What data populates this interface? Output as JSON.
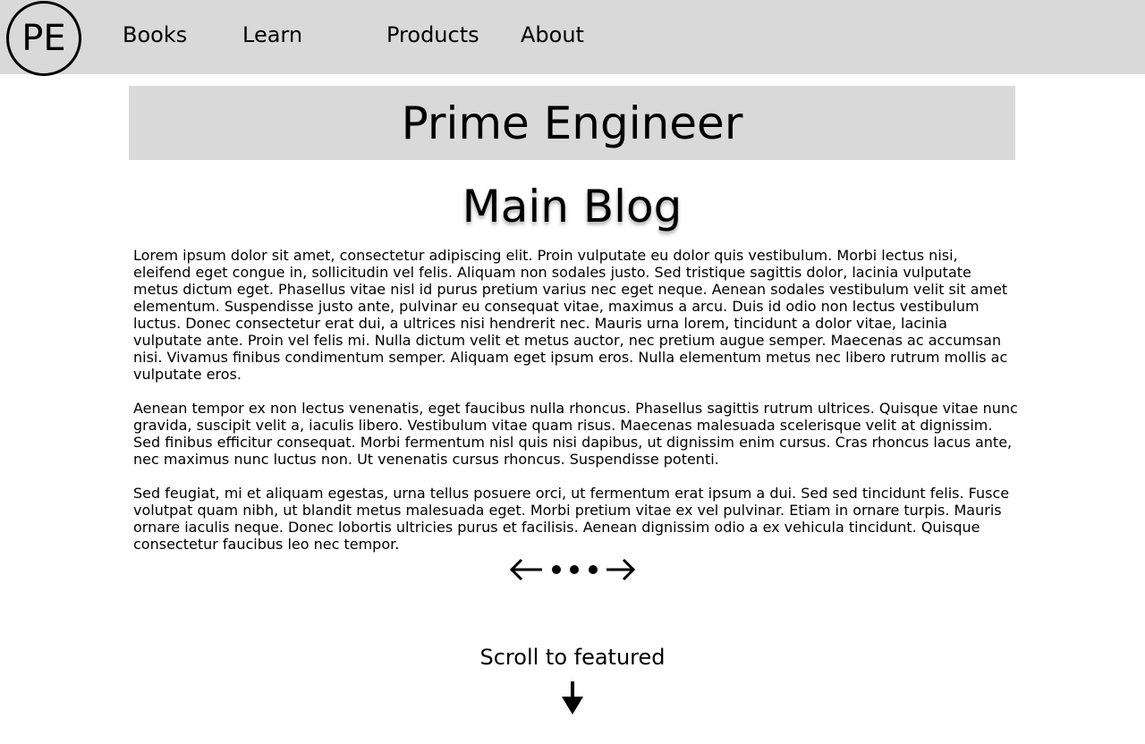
{
  "nav": {
    "logo_text": "PE",
    "items": [
      {
        "label": "Books"
      },
      {
        "label": "Learn"
      },
      {
        "label": "Products"
      },
      {
        "label": "About"
      }
    ]
  },
  "banner": {
    "title": "Prime Engineer"
  },
  "blog": {
    "heading": "Main Blog",
    "paragraphs": [
      "Lorem ipsum dolor sit amet, consectetur adipiscing elit. Proin vulputate eu dolor quis vestibulum. Morbi lectus nisi, eleifend eget congue in, sollicitudin vel felis. Aliquam non sodales justo. Sed tristique sagittis dolor, lacinia vulputate metus dictum eget. Phasellus vitae nisl id purus pretium varius nec eget neque. Aenean sodales vestibulum velit sit amet elementum. Suspendisse justo ante, pulvinar eu consequat vitae, maximus a arcu. Duis id odio non lectus vestibulum luctus. Donec consectetur erat dui, a ultrices nisi hendrerit nec. Mauris urna lorem, tincidunt a dolor vitae, lacinia vulputate ante. Proin vel felis mi. Nulla dictum velit et metus auctor, nec pretium augue semper. Maecenas ac accumsan nisi. Vivamus finibus condimentum semper. Aliquam eget ipsum eros. Nulla elementum metus nec libero rutrum mollis ac vulputate eros.",
      "Aenean tempor ex non lectus venenatis, eget faucibus nulla rhoncus. Phasellus sagittis rutrum ultrices. Quisque vitae nunc gravida, suscipit velit a, iaculis libero. Vestibulum vitae quam risus. Maecenas malesuada scelerisque velit at dignissim. Sed finibus efficitur consequat. Morbi fermentum nisl quis nisi dapibus, ut dignissim enim cursus. Cras rhoncus lacus ante, nec maximus nunc luctus non. Ut venenatis cursus rhoncus. Suspendisse potenti.",
      "Sed feugiat, mi et aliquam egestas, urna tellus posuere orci, ut fermentum erat ipsum a dui. Sed sed tincidunt felis. Fusce volutpat quam nibh, ut blandit metus malesuada eget. Morbi pretium vitae ex vel pulvinar. Etiam in ornare turpis. Mauris ornare iaculis neque. Donec lobortis ultricies purus et facilisis. Aenean dignissim odio a ex vehicula tincidunt. Quisque consectetur faucibus leo nec tempor."
    ]
  },
  "pager": {
    "prev_icon": "arrow-left-icon",
    "next_icon": "arrow-right-icon",
    "dot_count": 3
  },
  "scroll": {
    "label": "Scroll to featured",
    "icon": "arrow-down-icon"
  },
  "colors": {
    "bar_background": "#d9d9d9",
    "text": "#000000",
    "page_background": "#ffffff"
  }
}
